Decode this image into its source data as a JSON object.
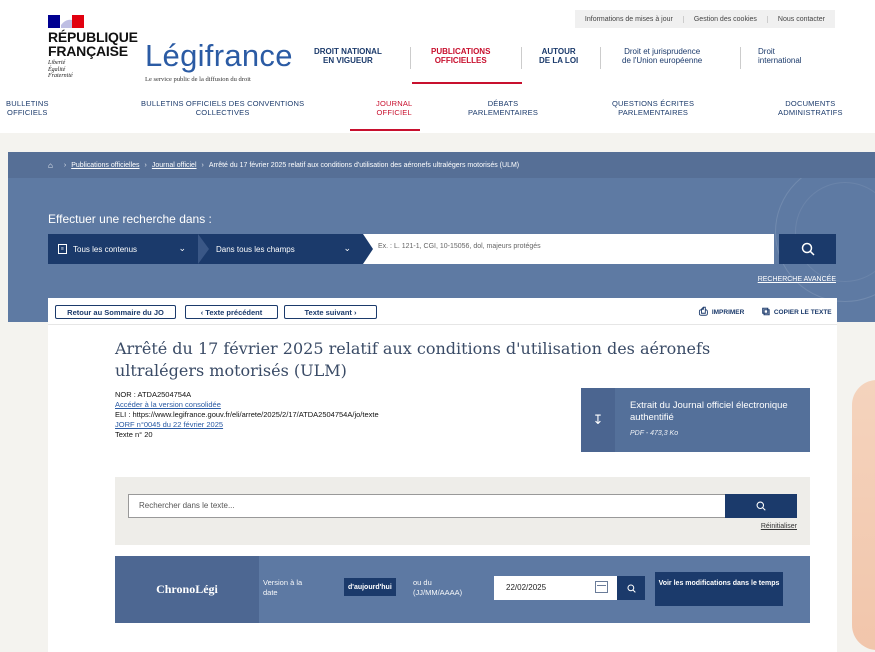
{
  "header": {
    "top_links": [
      "Informations de mises à jour",
      "Gestion des cookies",
      "Nous contacter"
    ],
    "republique_line1": "RÉPUBLIQUE",
    "republique_line2": "FRANÇAISE",
    "motto": [
      "Liberté",
      "Égalité",
      "Fraternité"
    ],
    "logo": "Légifrance",
    "tagline": "Le service public de la diffusion du droit",
    "main_nav": [
      {
        "line1": "DROIT NATIONAL",
        "line2": "EN VIGUEUR"
      },
      {
        "line1": "PUBLICATIONS",
        "line2": "OFFICIELLES"
      },
      {
        "line1": "AUTOUR",
        "line2": "DE LA LOI"
      },
      {
        "line1": "Droit et jurisprudence",
        "line2": "de l'Union européenne"
      },
      {
        "line1": "Droit",
        "line2": "international"
      }
    ],
    "sub_nav": [
      {
        "line1": "BULLETINS",
        "line2": "OFFICIELS"
      },
      {
        "line1": "BULLETINS OFFICIELS DES CONVENTIONS",
        "line2": "COLLECTIVES"
      },
      {
        "line1": "JOURNAL",
        "line2": "OFFICIEL"
      },
      {
        "line1": "DÉBATS",
        "line2": "PARLEMENTAIRES"
      },
      {
        "line1": "QUESTIONS ÉCRITES",
        "line2": "PARLEMENTAIRES"
      },
      {
        "line1": "DOCUMENTS",
        "line2": "ADMINISTRATIFS"
      }
    ]
  },
  "breadcrumb": {
    "home_icon": "home-icon",
    "items": [
      "Publications officielles",
      "Journal officiel",
      "Arrêté du 17 février 2025 relatif aux conditions d'utilisation des aéronefs ultralégers motorisés (ULM)"
    ]
  },
  "search": {
    "label": "Effectuer une recherche dans :",
    "scope": "Tous les contenus",
    "field": "Dans tous les champs",
    "placeholder": "Ex. : L. 121-1, CGI, 10-15056, dol, majeurs protégés",
    "advanced": "RECHERCHE AVANCÉE"
  },
  "toolbar": {
    "back": "Retour au Sommaire du JO",
    "prev": "‹ Texte précédent",
    "next": "Texte suivant ›",
    "print": "IMPRIMER",
    "copy": "COPIER LE TEXTE"
  },
  "document": {
    "title": "Arrêté du 17 février 2025 relatif aux conditions d'utilisation des aéronefs ultralégers motorisés (ULM)",
    "nor": "NOR : ATDA2504754A",
    "consolidated_link": "Accéder à la version consolidée",
    "eli": "ELI : https://www.legifrance.gouv.fr/eli/arrete/2025/2/17/ATDA2504754A/jo/texte",
    "jorf_link": "JORF n°0045 du 22 février 2025",
    "texte_num": "Texte n° 20"
  },
  "extrait": {
    "title": "Extrait du Journal officiel électronique authentifié",
    "meta": "PDF - 473,3 Ko"
  },
  "in_text_search": {
    "placeholder": "Rechercher dans le texte...",
    "reset": "Réinitialiser"
  },
  "chrono": {
    "title": "ChronoLégi",
    "version_label_1": "Version à la",
    "version_label_2": "date",
    "today": "d'aujourd'hui",
    "or_label_1": "ou du",
    "or_label_2": "(JJ/MM/AAAA)",
    "date_value": "22/02/2025",
    "modifications": "Voir les modifications dans le temps"
  }
}
